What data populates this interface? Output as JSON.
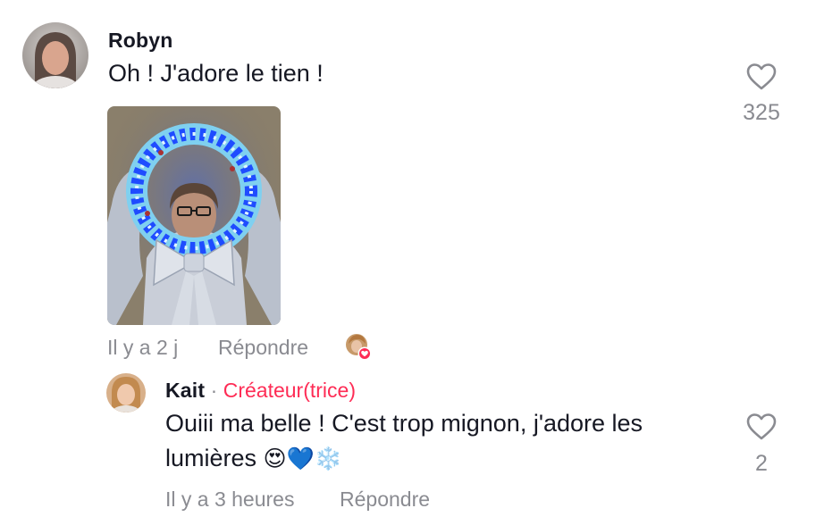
{
  "comment": {
    "username": "Robyn",
    "text": "Oh ! J'adore le tien !",
    "time": "Il y a 2 j",
    "reply_label": "Répondre",
    "likes": "325",
    "icons": {
      "avatar": "user-avatar",
      "like": "heart-outline-icon",
      "creator_liked": "creator-liked-badge"
    }
  },
  "reply": {
    "username": "Kait",
    "separator": "·",
    "badge": "Créateur(trice)",
    "text_line1": "Ouiii ma belle ! C'est trop mignon, j'adore les",
    "text_line2": "lumières",
    "emojis": [
      "😍",
      "💙",
      "❄️"
    ],
    "time": "Il y a 3 heures",
    "reply_label": "Répondre",
    "likes": "2"
  },
  "colors": {
    "creator_badge": "#fe2c55",
    "muted": "#8a8b91",
    "text": "#161823"
  }
}
